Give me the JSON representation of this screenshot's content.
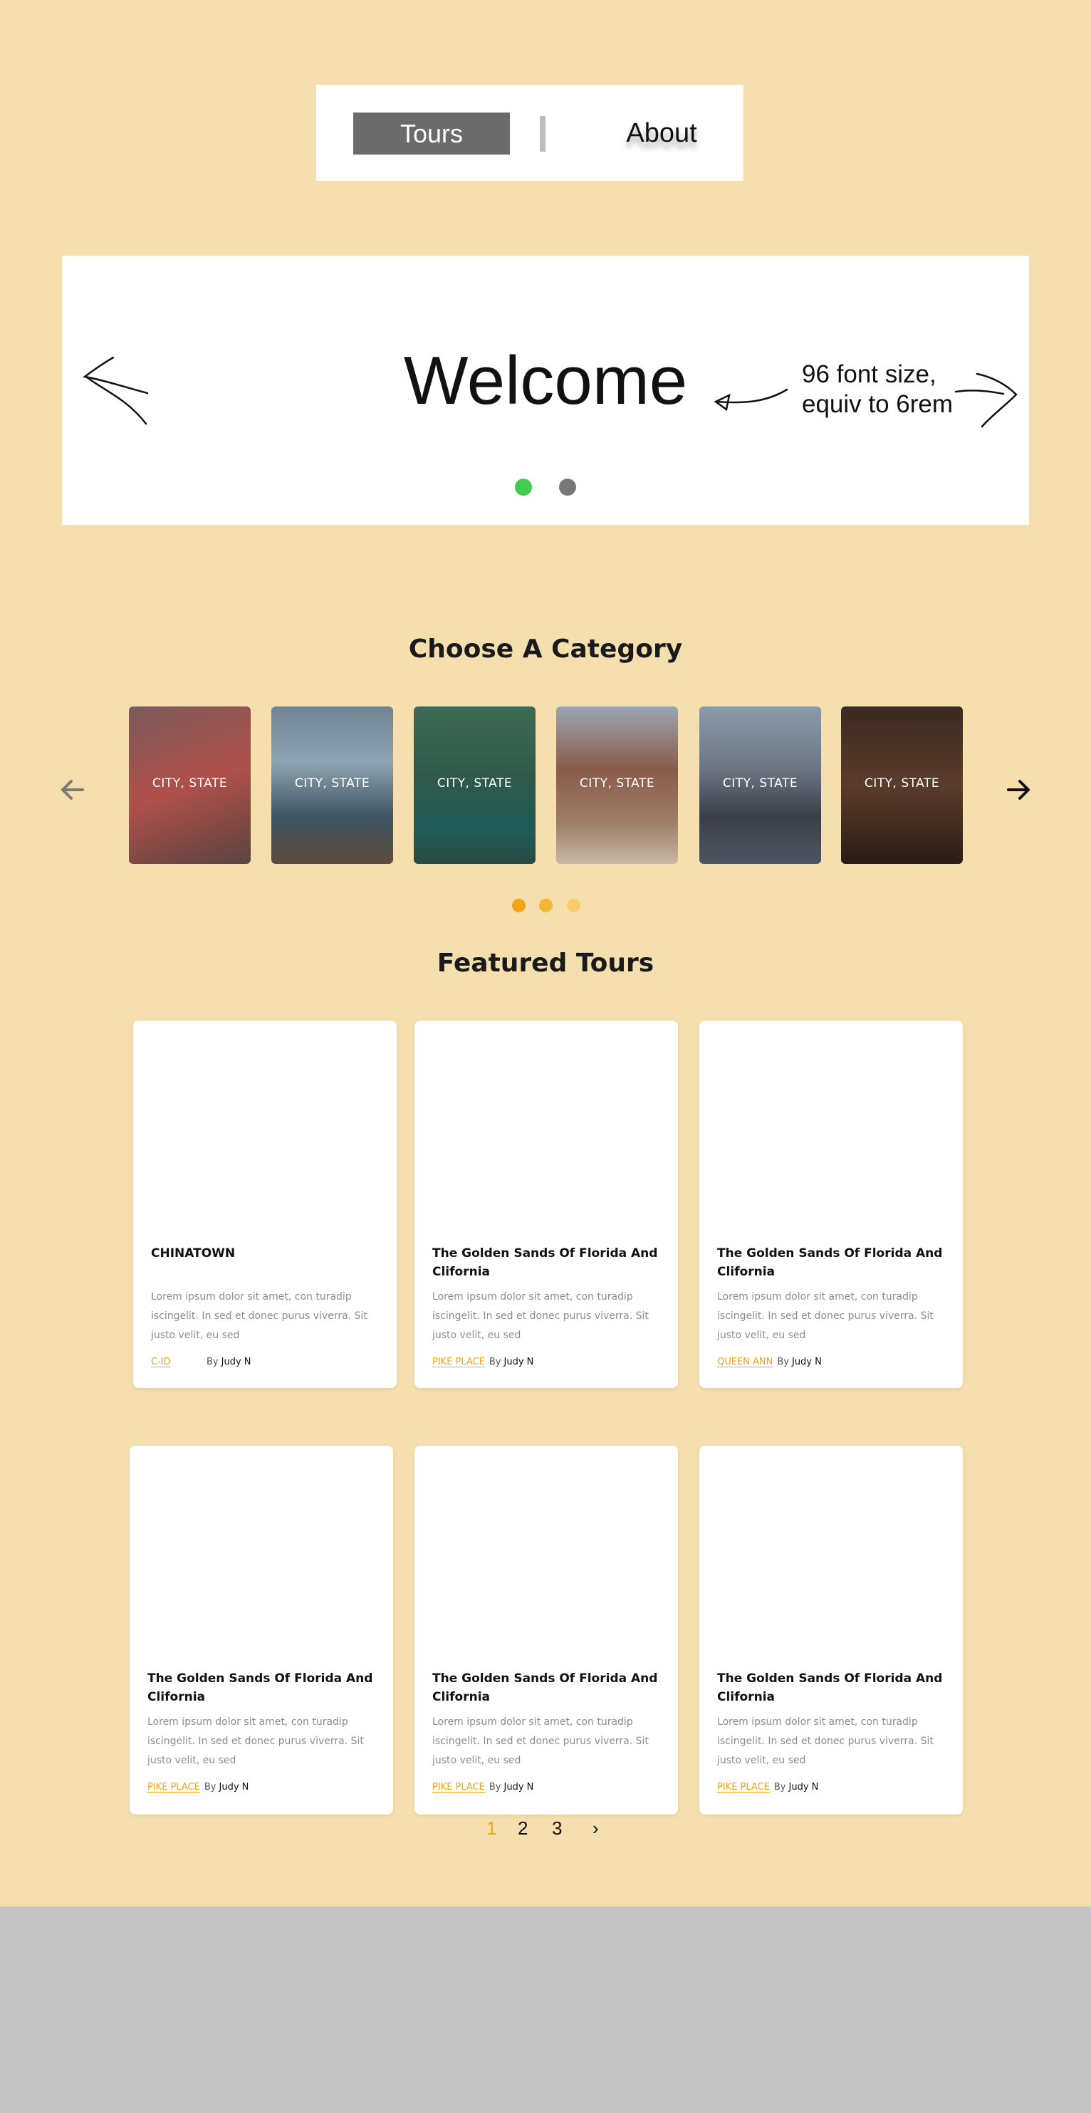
{
  "nav": {
    "tours_label": "Tours",
    "about_label": "About"
  },
  "hero": {
    "title": "Welcome",
    "note_line1": "96 font size,",
    "note_line2": "equiv to 6rem",
    "dot_active_color": "#43cb4f",
    "dot_inactive_color": "#787878"
  },
  "categories": {
    "heading": "Choose A Category",
    "items": [
      {
        "label": "CITY, STATE",
        "bg": "linear-gradient(160deg,#7a5a5a,#b0504a 50%,#5b4340)"
      },
      {
        "label": "CITY, STATE",
        "bg": "linear-gradient(180deg,#6f8391,#8fa4b2 35%,#3f5663 70%,#5d4a3d)"
      },
      {
        "label": "CITY, STATE",
        "bg": "linear-gradient(180deg,#3e6b55,#2f5a4b 45%,#1f5a5a 80%,#2b4a40)"
      },
      {
        "label": "CITY, STATE",
        "bg": "linear-gradient(180deg,#9aa6b3,#8a5a4a 40%,#a0806a 75%,#c8b8a5)"
      },
      {
        "label": "CITY, STATE",
        "bg": "linear-gradient(180deg,#8c9aa8,#6c7682 40%,#3a3e48 70%,#4c5660)"
      },
      {
        "label": "CITY, STATE",
        "bg": "linear-gradient(180deg,#3a2a22,#5a3c2c 50%,#2a1c16)"
      }
    ],
    "prev_icon": "arrow-left-icon",
    "next_icon": "arrow-right-icon",
    "dot_colors": [
      "#f5a414",
      "#f7b535",
      "#f9cc6e"
    ]
  },
  "featured": {
    "heading": "Featured Tours",
    "cards": [
      {
        "title": "CHINATOWN",
        "desc": "Lorem ipsum dolor sit amet, con turadip iscingelit. In sed et donec purus viverra. Sit justo velit, eu sed",
        "tag": "C-ID",
        "by": "By",
        "author": "Judy N"
      },
      {
        "title": "The Golden Sands Of Florida And Clifornia",
        "desc": "Lorem ipsum dolor sit amet, con turadip iscingelit. In sed et donec purus viverra. Sit justo velit, eu sed",
        "tag": "PIKE PLACE",
        "by": "By",
        "author": "Judy N"
      },
      {
        "title": "The Golden Sands Of Florida And Clifornia",
        "desc": "Lorem ipsum dolor sit amet, con turadip iscingelit. In sed et donec purus viverra. Sit justo velit, eu sed",
        "tag": "QUEEN ANN",
        "by": "By",
        "author": "Judy N"
      },
      {
        "title": "The Golden Sands Of Florida And Clifornia",
        "desc": "Lorem ipsum dolor sit amet, con turadip iscingelit. In sed et donec purus viverra. Sit justo velit, eu sed",
        "tag": "PIKE PLACE",
        "by": "By",
        "author": "Judy N"
      },
      {
        "title": "The Golden Sands Of Florida And Clifornia",
        "desc": "Lorem ipsum dolor sit amet, con turadip iscingelit. In sed et donec purus viverra. Sit justo velit, eu sed",
        "tag": "PIKE PLACE",
        "by": "By",
        "author": "Judy N"
      },
      {
        "title": "The Golden Sands Of Florida And Clifornia",
        "desc": "Lorem ipsum dolor sit amet, con turadip iscingelit. In sed et donec purus viverra. Sit justo velit, eu sed",
        "tag": "PIKE PLACE",
        "by": "By",
        "author": "Judy N"
      }
    ]
  },
  "pagination": {
    "pages": [
      "1",
      "2",
      "3"
    ],
    "active_page": "1",
    "next_label": "›",
    "accent_color": "#f5a414"
  },
  "colors": {
    "page_bg": "#f5dfae",
    "footer_bg": "#c4c4c4",
    "accent": "#f5a414"
  }
}
